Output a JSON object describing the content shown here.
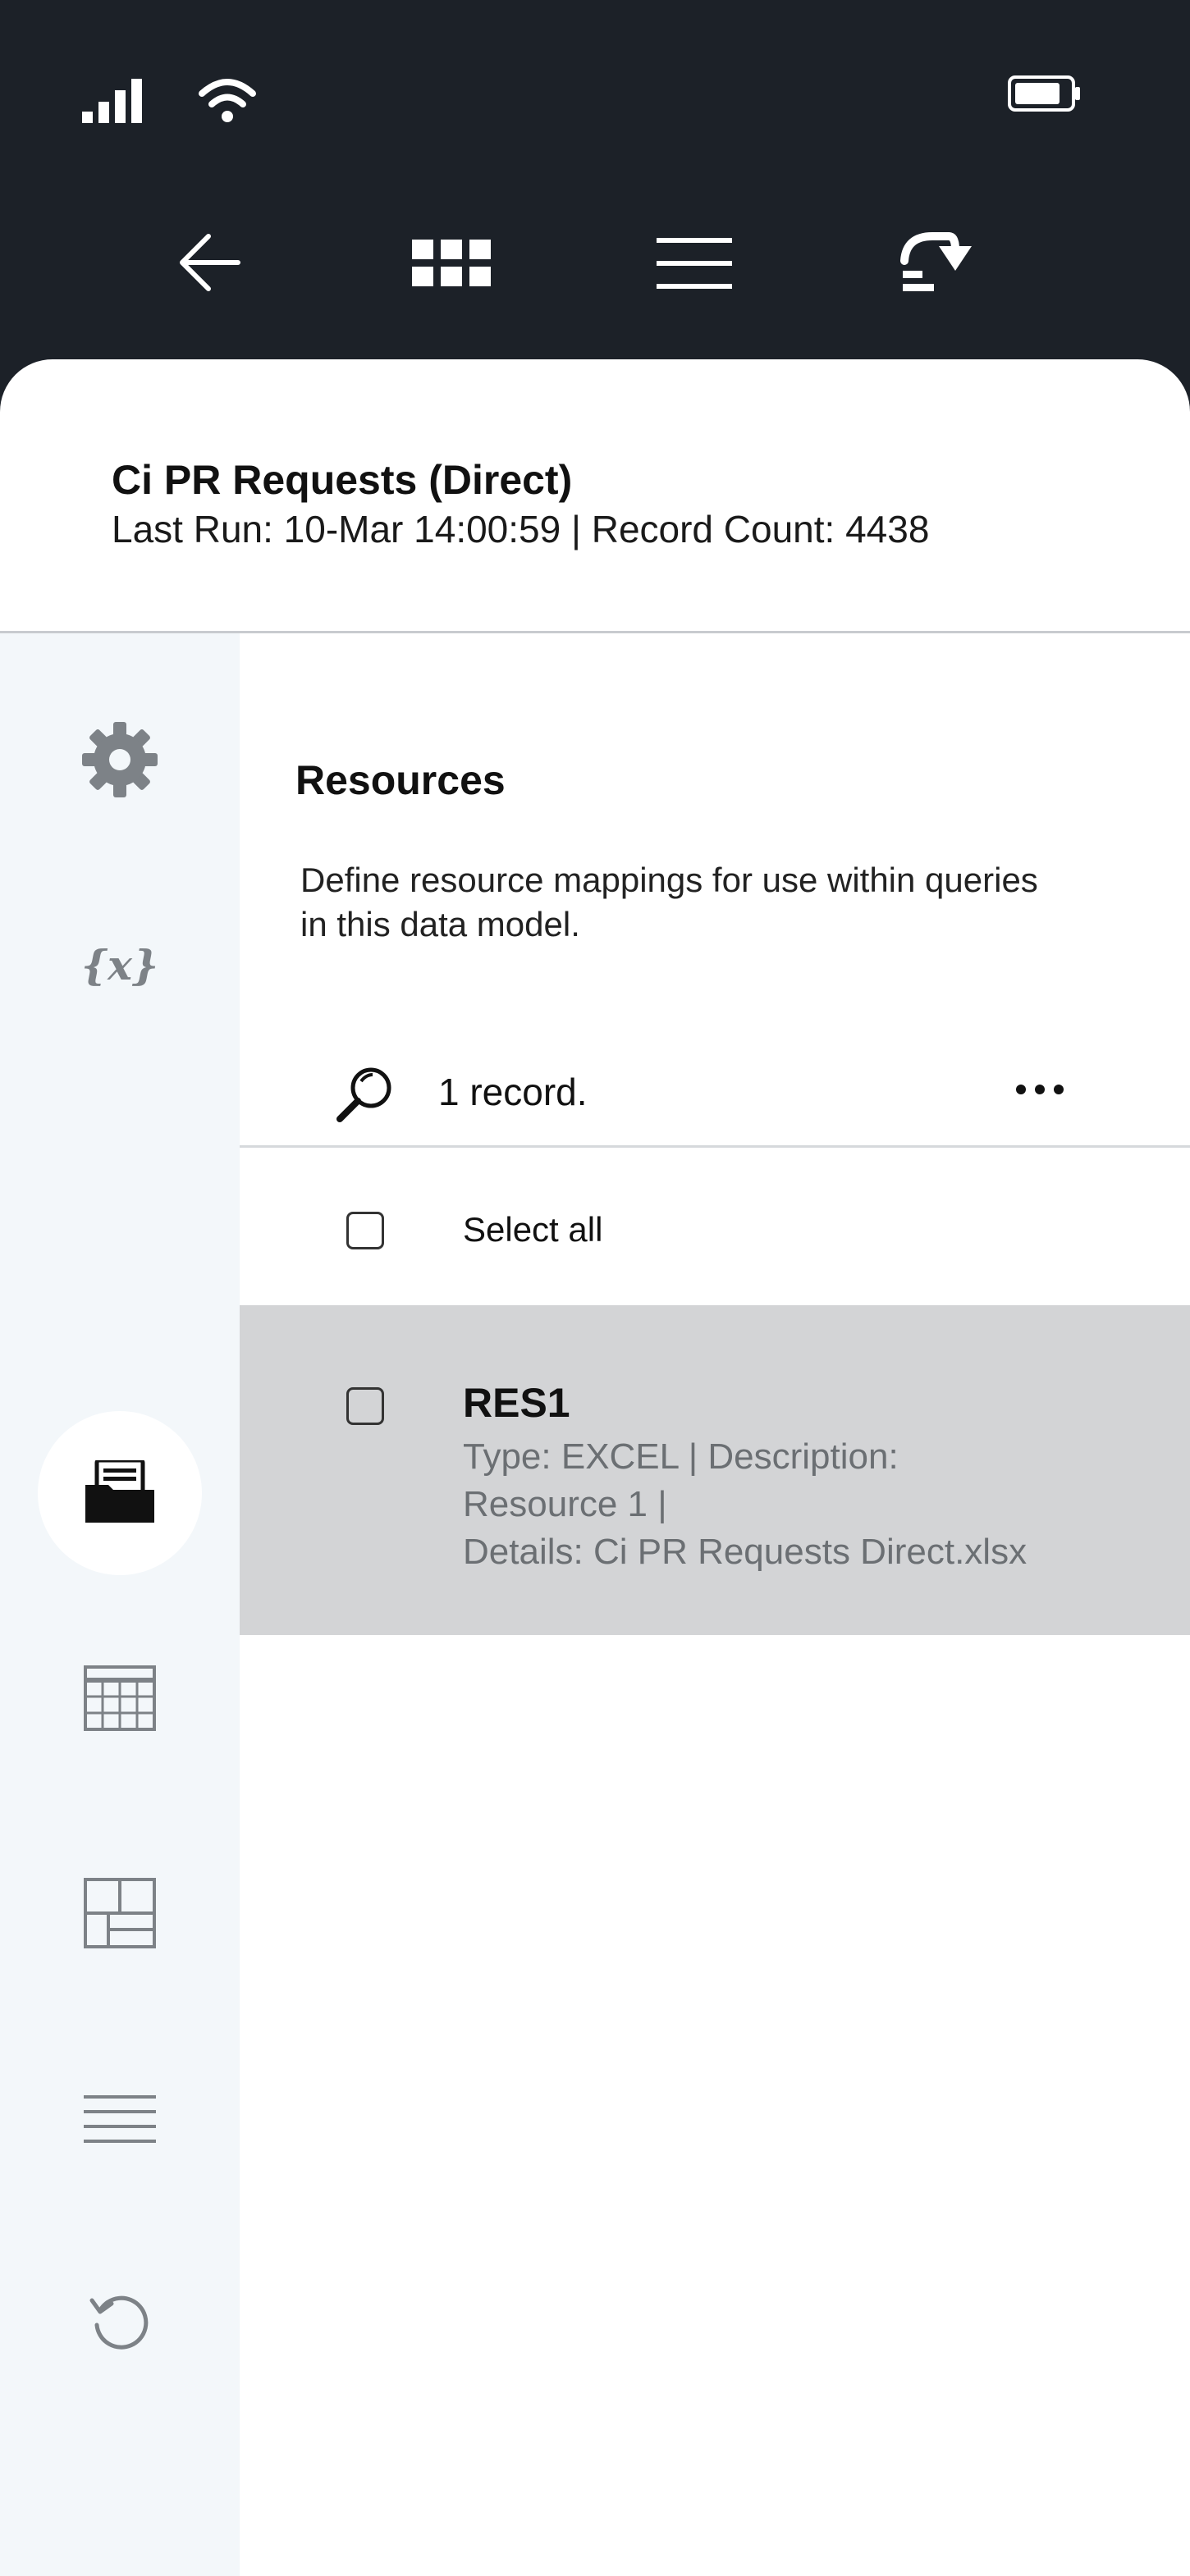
{
  "status_bar": {
    "icons": [
      "signal-icon",
      "wifi-icon",
      "battery-icon"
    ]
  },
  "toolbar": {
    "icons": [
      "back-arrow-icon",
      "grid-icon",
      "menu-icon",
      "run-download-icon"
    ]
  },
  "header": {
    "title": "Ci PR Requests (Direct)",
    "subtitle": "Last Run: 10-Mar 14:00:59 | Record Count: 4438"
  },
  "rail": {
    "items": [
      {
        "icon": "gear-icon",
        "active": false
      },
      {
        "icon": "variables-icon",
        "label": "{x}",
        "active": false
      },
      {
        "icon": "folder-icon",
        "active": true
      },
      {
        "icon": "table-icon",
        "active": false
      },
      {
        "icon": "layout-icon",
        "active": false
      },
      {
        "icon": "lines-icon",
        "active": false
      },
      {
        "icon": "history-icon",
        "active": false
      }
    ]
  },
  "main": {
    "title": "Resources",
    "description": "Define resource mappings for use within queries in this data model.",
    "record_count": "1 record.",
    "select_all_label": "Select all",
    "records": [
      {
        "name": "RES1",
        "line1": "Type: EXCEL | Description:",
        "line2": "Resource 1 |",
        "line3": "Details: Ci PR Requests Direct.xlsx"
      }
    ]
  },
  "colors": {
    "dark_bar": "#1c2128",
    "rail_bg": "#f3f7fa",
    "selected_row": "#d3d4d6",
    "muted_text": "#6b6f73"
  }
}
